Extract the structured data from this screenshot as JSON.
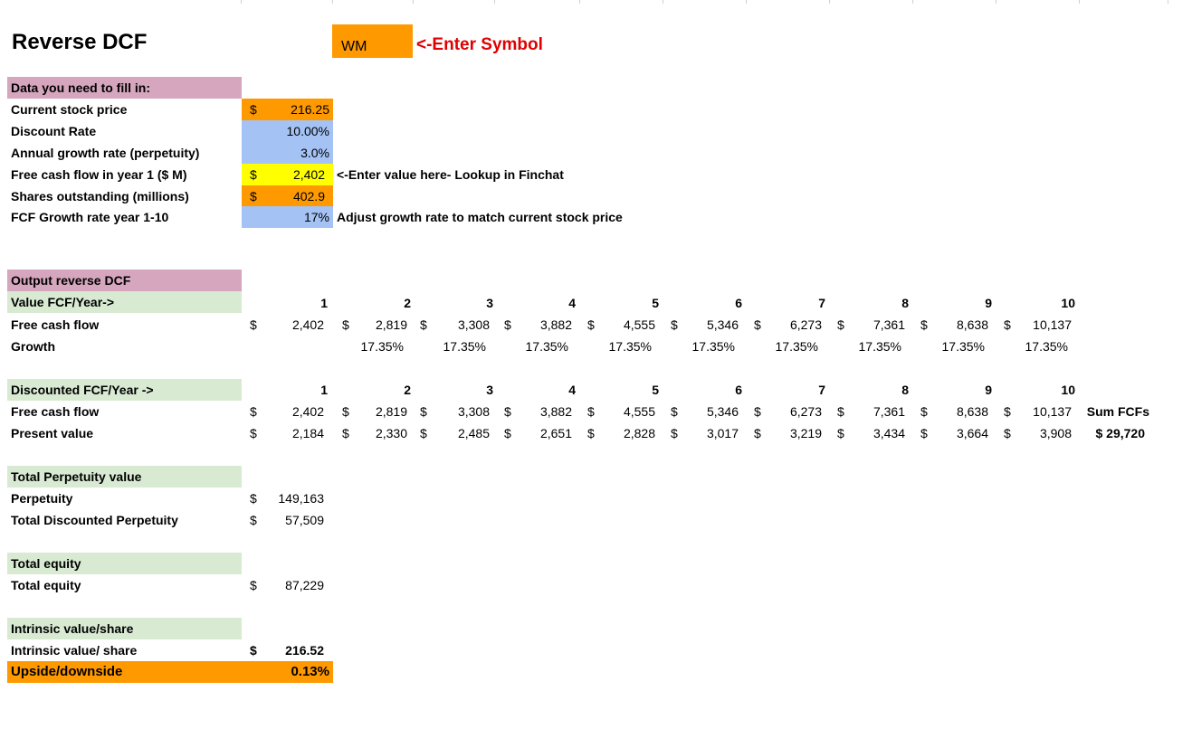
{
  "title": "Reverse DCF",
  "symbol": {
    "value": "WM",
    "hint": "<-Enter Symbol"
  },
  "inputs": {
    "section_label": "Data you need to fill in:",
    "rows": [
      {
        "label": "Current stock price",
        "dollar": "$",
        "value": "216.25",
        "note": ""
      },
      {
        "label": "Discount Rate",
        "dollar": "",
        "value": "10.00%",
        "note": ""
      },
      {
        "label": "Annual growth rate (perpetuity)",
        "dollar": "",
        "value": "3.0%",
        "note": ""
      },
      {
        "label": "Free cash flow in year 1 ($ M)",
        "dollar": "$",
        "value": "2,402",
        "note": "<-Enter value here- Lookup in Finchat"
      },
      {
        "label": "Shares outstanding (millions)",
        "dollar": "$",
        "value": "402.9",
        "note": ""
      },
      {
        "label": "FCF Growth rate year 1-10",
        "dollar": "",
        "value": "17%",
        "note": "Adjust growth rate to match current stock price"
      }
    ]
  },
  "output": {
    "section_label": "Output reverse DCF",
    "years": [
      "1",
      "2",
      "3",
      "4",
      "5",
      "6",
      "7",
      "8",
      "9",
      "10"
    ],
    "value_header": "Value FCF/Year->",
    "fcf_label": "Free cash flow",
    "fcf_values": [
      "2,402",
      "2,819",
      "3,308",
      "3,882",
      "4,555",
      "5,346",
      "6,273",
      "7,361",
      "8,638",
      "10,137"
    ],
    "growth_label": "Growth",
    "growth_values": [
      "",
      "17.35%",
      "17.35%",
      "17.35%",
      "17.35%",
      "17.35%",
      "17.35%",
      "17.35%",
      "17.35%",
      "17.35%"
    ],
    "disc_header": "Discounted FCF/Year ->",
    "disc_fcf_label": "Free cash flow",
    "disc_fcf_values": [
      "2,402",
      "2,819",
      "3,308",
      "3,882",
      "4,555",
      "5,346",
      "6,273",
      "7,361",
      "8,638",
      "10,137"
    ],
    "sum_label": "Sum FCFs",
    "pv_label": "Present value",
    "pv_values": [
      "2,184",
      "2,330",
      "2,485",
      "2,651",
      "2,828",
      "3,017",
      "3,219",
      "3,434",
      "3,664",
      "3,908"
    ],
    "sum_value": "$ 29,720"
  },
  "perpetuity": {
    "header": "Total Perpetuity value",
    "perp_label": "Perpetuity",
    "perp_value": "149,163",
    "disc_label": "Total Discounted Perpetuity",
    "disc_value": "57,509"
  },
  "equity": {
    "header": "Total equity",
    "label": "Total equity",
    "value": "87,229"
  },
  "intrinsic": {
    "header": "Intrinsic value/share",
    "label": "Intrinsic value/ share",
    "value": "216.52",
    "upside_label": "Upside/downside",
    "upside_value": "0.13%"
  },
  "currency_symbol": "$",
  "colors": {
    "pink": "#d5a6bd",
    "green": "#d9ead3",
    "orange": "#ff9900",
    "blue": "#a4c2f4",
    "yellow": "#ffff00",
    "red": "#e00000"
  }
}
